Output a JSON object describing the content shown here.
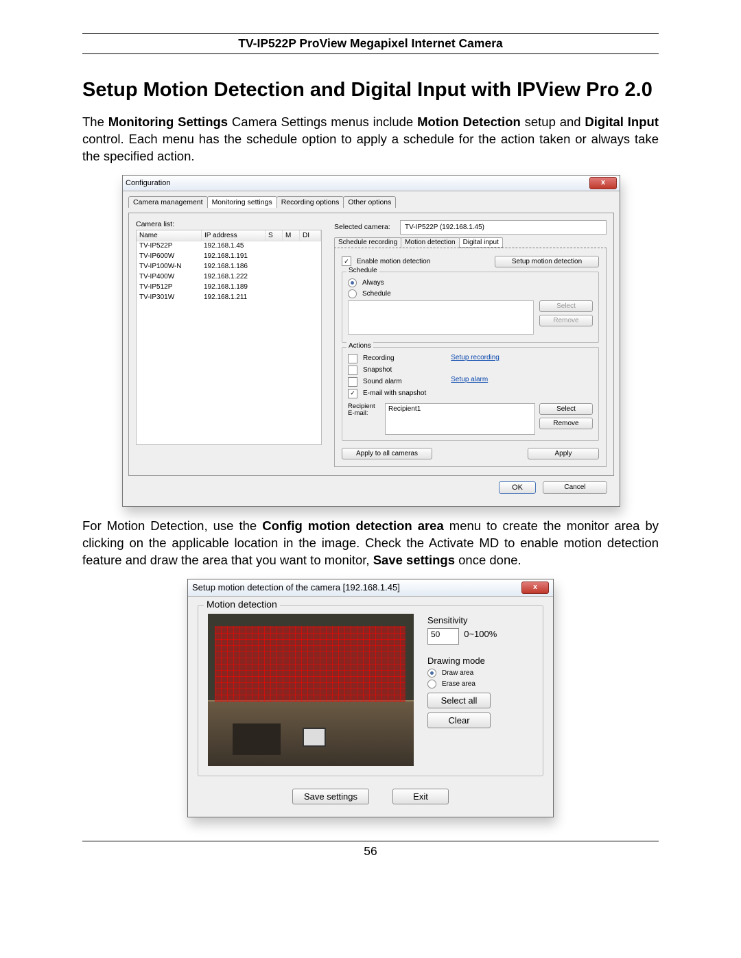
{
  "header": "TV-IP522P ProView Megapixel Internet Camera",
  "page_number": "56",
  "title": "Setup Motion Detection and Digital Input with IPView Pro 2.0",
  "para1_a": "The ",
  "para1_b": "Monitoring Settings",
  "para1_c": " Camera Settings menus include ",
  "para1_d": "Motion Detection",
  "para1_e": " setup and ",
  "para1_f": "Digital Input",
  "para1_g": " control. Each menu has the schedule option to apply a schedule for the action taken or always take the specified action.",
  "para2_a": "For Motion Detection, use the ",
  "para2_b": "Config motion detection area",
  "para2_c": " menu to create the monitor area by clicking on the applicable location in the image. Check the Activate MD to enable motion detection feature and draw the area that you want to monitor, ",
  "para2_d": "Save settings",
  "para2_e": " once done.",
  "cfg": {
    "title": "Configuration",
    "close": "x",
    "tabs": {
      "cam": "Camera management",
      "mon": "Monitoring settings",
      "rec": "Recording options",
      "oth": "Other options"
    },
    "camlist": "Camera list:",
    "cols": {
      "name": "Name",
      "ip": "IP address",
      "s": "S",
      "m": "M",
      "di": "DI"
    },
    "rows": [
      {
        "n": "TV-IP522P",
        "i": "192.168.1.45"
      },
      {
        "n": "TV-IP600W",
        "i": "192.168.1.191"
      },
      {
        "n": "TV-IP100W-N",
        "i": "192.168.1.186"
      },
      {
        "n": "TV-IP400W",
        "i": "192.168.1.222"
      },
      {
        "n": "TV-IP512P",
        "i": "192.168.1.189"
      },
      {
        "n": "TV-IP301W",
        "i": "192.168.1.211"
      }
    ],
    "selcam_l": "Selected camera:",
    "selcam_v": "TV-IP522P (192.168.1.45)",
    "subtabs": {
      "sr": "Schedule recording",
      "md": "Motion detection",
      "di": "Digital input"
    },
    "enable": "Enable motion detection",
    "setupmd": "Setup motion detection",
    "schedule": "Schedule",
    "always": "Always",
    "schedule_r": "Schedule",
    "select": "Select",
    "remove": "Remove",
    "actions": "Actions",
    "recording": "Recording",
    "snapshot": "Snapshot",
    "sound": "Sound alarm",
    "email": "E-mail with snapshot",
    "setuprec": "Setup recording",
    "setupalarm": "Setup alarm",
    "recip": "Recipient E-mail:",
    "recipval": "Recipient1",
    "applyall": "Apply to all cameras",
    "apply": "Apply",
    "ok": "OK",
    "cancel": "Cancel"
  },
  "md": {
    "title": "Setup motion detection of the camera [192.168.1.45]",
    "close": "x",
    "legend": "Motion detection",
    "sens": "Sensitivity",
    "sensval": "50",
    "sensrange": "0~100%",
    "drawmode": "Drawing mode",
    "draw": "Draw area",
    "erase": "Erase area",
    "selall": "Select all",
    "clear": "Clear",
    "save": "Save settings",
    "exit": "Exit"
  }
}
